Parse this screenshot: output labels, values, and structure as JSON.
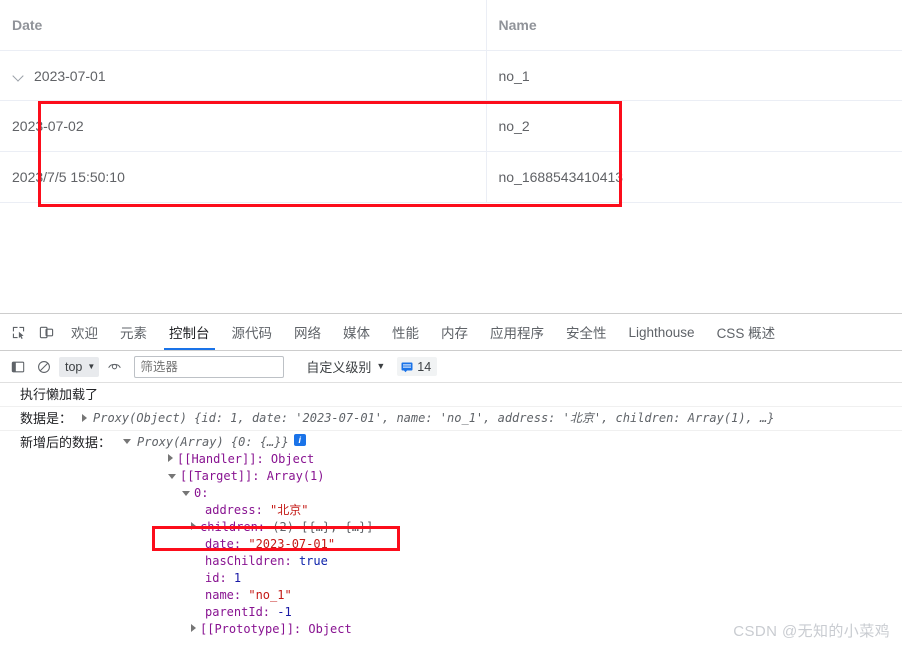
{
  "table": {
    "columns": [
      {
        "key": "date",
        "label": "Date"
      },
      {
        "key": "name",
        "label": "Name"
      }
    ],
    "rows": [
      {
        "date": "2023-07-01",
        "name": "no_1",
        "level": 0,
        "expanded": true
      },
      {
        "date": "2023-07-02",
        "name": "no_2",
        "level": 1,
        "expanded": false
      },
      {
        "date": "2023/7/5 15:50:10",
        "name": "no_1688543410413",
        "level": 1,
        "expanded": false
      }
    ],
    "annotation_color": "#fc0d1b"
  },
  "devtools": {
    "tabs": [
      {
        "label": "欢迎",
        "active": false
      },
      {
        "label": "元素",
        "active": false
      },
      {
        "label": "控制台",
        "active": true
      },
      {
        "label": "源代码",
        "active": false
      },
      {
        "label": "网络",
        "active": false
      },
      {
        "label": "媒体",
        "active": false
      },
      {
        "label": "性能",
        "active": false
      },
      {
        "label": "内存",
        "active": false
      },
      {
        "label": "应用程序",
        "active": false
      },
      {
        "label": "安全性",
        "active": false
      },
      {
        "label": "Lighthouse",
        "active": false
      },
      {
        "label": "CSS 概述",
        "active": false
      }
    ],
    "active_tab_accent": "#1a73e8",
    "toolbar": {
      "context_value": "top",
      "filter_placeholder": "筛选器",
      "filter_value": "",
      "level_label": "自定义级别",
      "issues_count": "14"
    }
  },
  "console": {
    "entries": [
      {
        "type": "text",
        "label": "执行懒加载了"
      },
      {
        "type": "object",
        "label": "数据是：",
        "preview": "Proxy(Object) {id: 1, date: '2023-07-01', name: 'no_1', address: '北京', children: Array(1), …}"
      },
      {
        "type": "tree",
        "label": "新增后的数据：",
        "root": "Proxy(Array) {0: {…}}"
      }
    ],
    "tree_lines": [
      {
        "indent": 1,
        "caret": "right",
        "text": "[[Handler]]: Object"
      },
      {
        "indent": 1,
        "caret": "down",
        "text": "[[Target]]: Array(1)"
      },
      {
        "indent": 2,
        "caret": "down",
        "text": "0:"
      },
      {
        "indent": 3,
        "caret": "none",
        "key": "address:",
        "value": "\"北京\"",
        "vtype": "str"
      },
      {
        "indent": 3,
        "caret": "right",
        "key": "children:",
        "value": "(2) [{…}, {…}]",
        "vtype": "dim",
        "highlighted": true
      },
      {
        "indent": 3,
        "caret": "none",
        "key": "date:",
        "value": "\"2023-07-01\"",
        "vtype": "str"
      },
      {
        "indent": 3,
        "caret": "none",
        "key": "hasChildren:",
        "value": "true",
        "vtype": "bool"
      },
      {
        "indent": 3,
        "caret": "none",
        "key": "id:",
        "value": "1",
        "vtype": "num"
      },
      {
        "indent": 3,
        "caret": "none",
        "key": "name:",
        "value": "\"no_1\"",
        "vtype": "str"
      },
      {
        "indent": 3,
        "caret": "none",
        "key": "parentId:",
        "value": "-1",
        "vtype": "num"
      },
      {
        "indent": 2,
        "caret": "right",
        "text": "[[Prototype]]: Object"
      }
    ]
  },
  "watermark": "CSDN @无知的小菜鸡"
}
